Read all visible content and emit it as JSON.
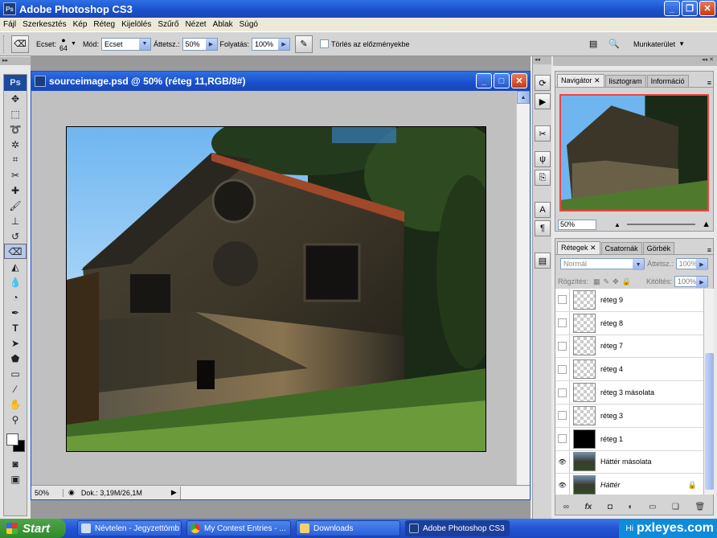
{
  "app": {
    "title": "Adobe Photoshop CS3",
    "logo": "Ps"
  },
  "menu": [
    "Fájl",
    "Szerkesztés",
    "Kép",
    "Réteg",
    "Kijelölés",
    "Szűrő",
    "Nézet",
    "Ablak",
    "Súgó"
  ],
  "options": {
    "brush_label": "Ecset:",
    "brush_size": "64",
    "mode_label": "Mód:",
    "mode_value": "Ecset",
    "opacity_label": "Áttetsz.:",
    "opacity_value": "50%",
    "flow_label": "Folyatás:",
    "flow_value": "100%",
    "erase_history_label": "Törlés az előzményekbe",
    "workspace_label": "Munkaterület"
  },
  "document": {
    "title": "sourceimage.psd @ 50% (réteg 11,RGB/8#)",
    "zoom": "50%",
    "doc_info": "Dok.: 3,19M/26,1M"
  },
  "navigator": {
    "tabs": [
      "Navigátor",
      "lisztogram",
      "Információ"
    ],
    "zoom": "50%"
  },
  "layers_panel": {
    "tabs": [
      "Rétegek",
      "Csatornák",
      "Görbék"
    ],
    "blend_mode": "Normál",
    "opacity_label": "Áttetsz.:",
    "opacity_value": "100%",
    "lock_label": "Rögzítés:",
    "fill_label": "Kitöltés:",
    "fill_value": "100%",
    "layers": [
      {
        "name": "réteg 9",
        "visible": false,
        "thumb": "transparent"
      },
      {
        "name": "réteg 8",
        "visible": false,
        "thumb": "transparent"
      },
      {
        "name": "réteg 7",
        "visible": false,
        "thumb": "transparent"
      },
      {
        "name": "réteg 4",
        "visible": false,
        "thumb": "transparent"
      },
      {
        "name": "réteg 3 másolata",
        "visible": false,
        "thumb": "transparent"
      },
      {
        "name": "réteg 3",
        "visible": false,
        "thumb": "transparent"
      },
      {
        "name": "réteg 1",
        "visible": false,
        "thumb": "black"
      },
      {
        "name": "Háttér másolata",
        "visible": true,
        "thumb": "photo"
      },
      {
        "name": "Háttér",
        "visible": true,
        "thumb": "photo",
        "locked": true
      }
    ]
  },
  "taskbar": {
    "start": "Start",
    "tasks": [
      "Névtelen - Jegyzettömb",
      "My Contest Entries - ...",
      "Downloads",
      "Adobe Photoshop CS3"
    ],
    "tray_text": "Hi",
    "watermark": "pxleyes.com"
  }
}
